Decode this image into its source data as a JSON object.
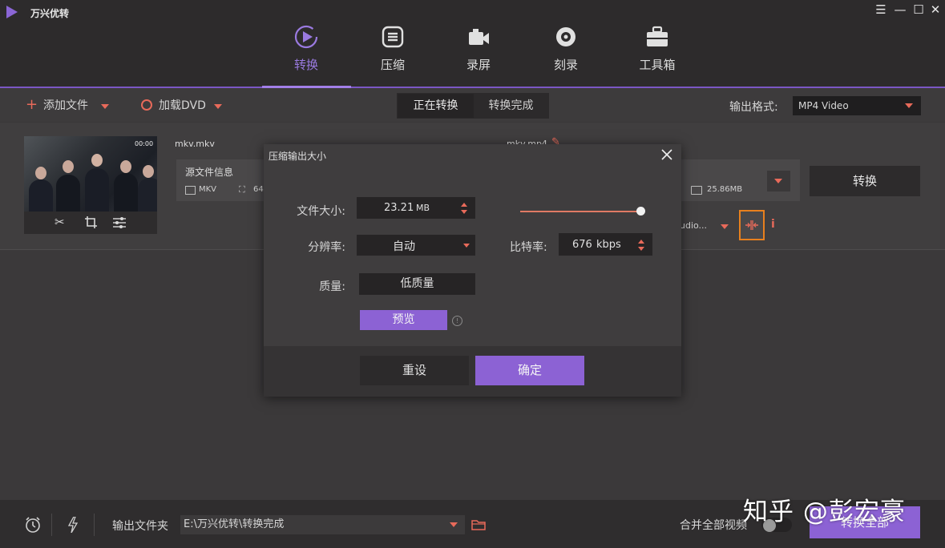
{
  "app": {
    "title": "万兴优转"
  },
  "window_controls": {
    "menu": "☰",
    "minimize": "—",
    "maximize": "☐",
    "close": "✕"
  },
  "nav": {
    "tabs": [
      {
        "label": "转换",
        "icon": "play-circle-icon",
        "active": true
      },
      {
        "label": "压缩",
        "icon": "compress-icon",
        "active": false
      },
      {
        "label": "录屏",
        "icon": "camera-icon",
        "active": false
      },
      {
        "label": "刻录",
        "icon": "disc-icon",
        "active": false
      },
      {
        "label": "工具箱",
        "icon": "toolbox-icon",
        "active": false
      }
    ]
  },
  "toolbar": {
    "add_file": "添加文件",
    "load_dvd": "加载DVD",
    "seg_converting": "正在转换",
    "seg_done": "转换完成",
    "output_format_label": "输出格式:",
    "output_format_value": "MP4 Video"
  },
  "file": {
    "src_name": "mkv.mkv",
    "dst_name": "mkv.mp4",
    "src_info_label": "源文件信息",
    "src_format": "MKV",
    "src_res_partial": "64",
    "dst_size": "25.86MB",
    "audio_partial": "udio...",
    "convert_label": "转换",
    "thumb_timestamp": "00:00"
  },
  "dialog": {
    "title": "压缩输出大小",
    "file_size_label": "文件大小:",
    "file_size_value": "23.21",
    "file_size_unit": "MB",
    "resolution_label": "分辨率:",
    "resolution_value": "自动",
    "bitrate_label": "比特率:",
    "bitrate_value": "676",
    "bitrate_unit": "kbps",
    "quality_label": "质量:",
    "quality_value": "低质量",
    "preview_label": "预览",
    "reset_label": "重设",
    "ok_label": "确定",
    "slider_level": 1.0,
    "accent": "#8c62d4"
  },
  "bottom": {
    "output_folder_label": "输出文件夹",
    "output_path": "E:\\万兴优转\\转换完成",
    "merge_label": "合并全部视频",
    "convert_all_label": "转换全部"
  },
  "watermark": "知乎 @彭宏豪"
}
